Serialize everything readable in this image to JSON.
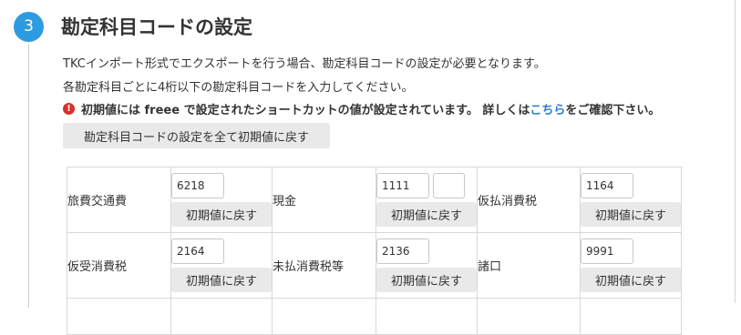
{
  "section": {
    "step_number": "3",
    "title": "勘定科目コードの設定"
  },
  "description": {
    "line1": "TKCインポート形式でエクスポートを行う場合、勘定科目コードの設定が必要となります。",
    "line2": "各勘定科目ごとに4桁以下の勘定科目コードを入力してください。"
  },
  "warning": {
    "icon": "exclamation-circle-icon",
    "text_before_link": "初期値には freee で設定されたショートカットの値が設定されています。 詳しくは",
    "link_text": "こちら",
    "text_after_link": "をご確認下さい。"
  },
  "reset_all_label": "勘定科目コードの設定を全て初期値に戻す",
  "reset_label": "初期値に戻す",
  "accounts": [
    {
      "name": "旅費交通費",
      "code": "6218"
    },
    {
      "name": "現金",
      "code": "1111",
      "sub_code": ""
    },
    {
      "name": "仮払消費税",
      "code": "1164"
    },
    {
      "name": "仮受消費税",
      "code": "2164"
    },
    {
      "name": "未払消費税等",
      "code": "2136"
    },
    {
      "name": "諸口",
      "code": "9991"
    }
  ],
  "colors": {
    "accent": "#2d9be0",
    "link": "#2d7bd4",
    "warning": "#d9302c",
    "button_bg": "#e9e9e9"
  }
}
